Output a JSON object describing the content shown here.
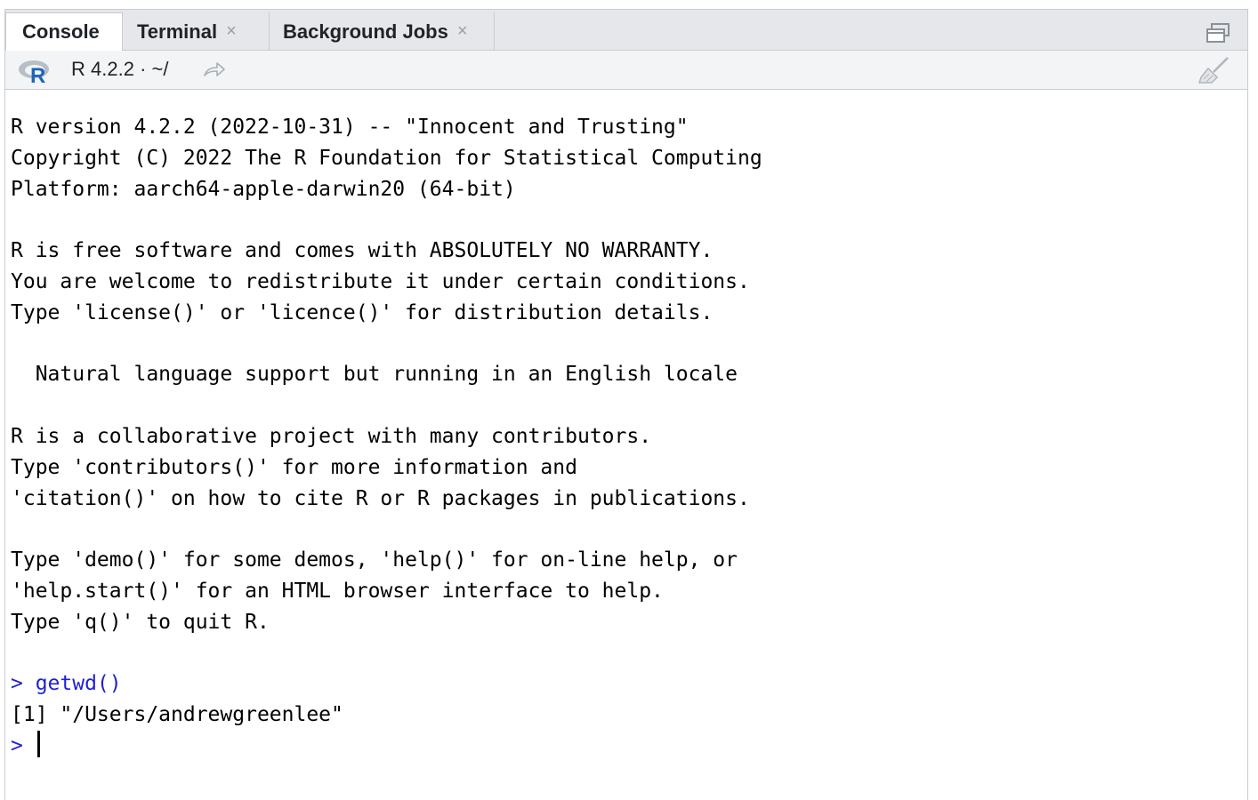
{
  "tabs": [
    {
      "label": "Console",
      "active": true,
      "closable": false
    },
    {
      "label": "Terminal",
      "active": false,
      "closable": true
    },
    {
      "label": "Background Jobs",
      "active": false,
      "closable": true
    }
  ],
  "toolbar": {
    "r_version": "R 4.2.2",
    "separator": "·",
    "working_dir": "~/"
  },
  "icons": {
    "maximize": "maximize-icon",
    "r_logo": "r-logo-icon",
    "go_to_dir": "arrow-right-icon",
    "clear_console": "broom-icon",
    "tab_close": "×"
  },
  "colors": {
    "command": "#1f1fd6",
    "r_logo_blue": "#1f65b7",
    "tab_bar_bg": "#e5e7ea"
  },
  "console": {
    "startup_lines": [
      "R version 4.2.2 (2022-10-31) -- \"Innocent and Trusting\"",
      "Copyright (C) 2022 The R Foundation for Statistical Computing",
      "Platform: aarch64-apple-darwin20 (64-bit)",
      "",
      "R is free software and comes with ABSOLUTELY NO WARRANTY.",
      "You are welcome to redistribute it under certain conditions.",
      "Type 'license()' or 'licence()' for distribution details.",
      "",
      "  Natural language support but running in an English locale",
      "",
      "R is a collaborative project with many contributors.",
      "Type 'contributors()' for more information and",
      "'citation()' on how to cite R or R packages in publications.",
      "",
      "Type 'demo()' for some demos, 'help()' for on-line help, or",
      "'help.start()' for an HTML browser interface to help.",
      "Type 'q()' to quit R.",
      ""
    ],
    "prompt": "> ",
    "command": "getwd()",
    "output": "[1] \"/Users/andrewgreenlee\"",
    "input_value": ""
  }
}
